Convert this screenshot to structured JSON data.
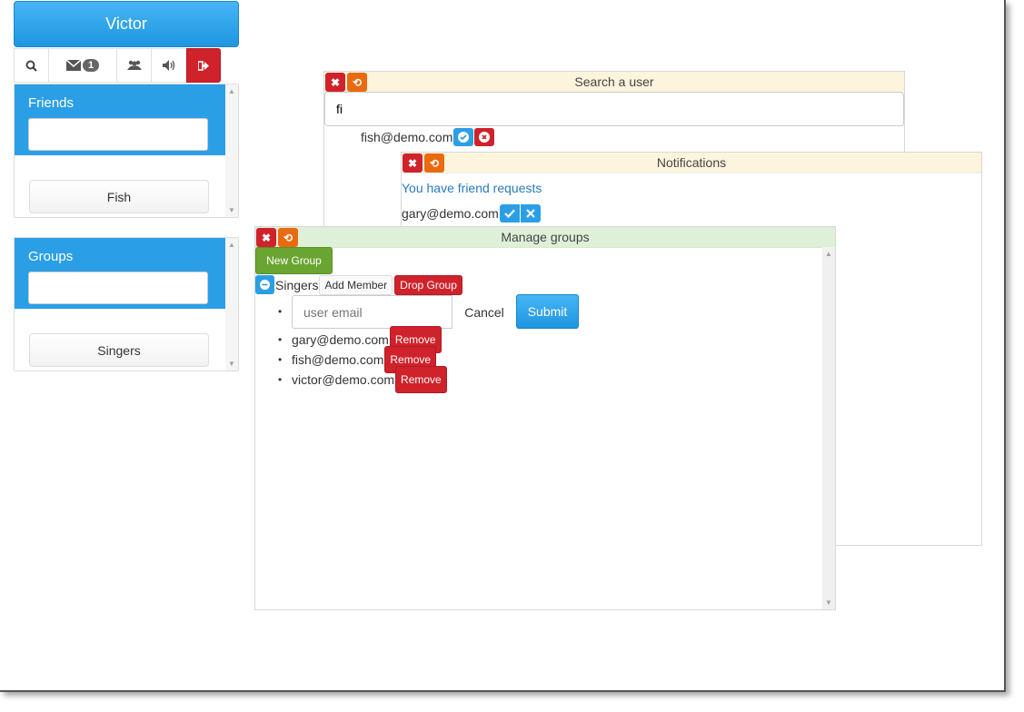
{
  "user": {
    "name": "Victor"
  },
  "toolbar": {
    "search_icon": "search-icon",
    "messages_icon": "envelope-icon",
    "messages_count": "1",
    "groups_icon": "users-icon",
    "sound_icon": "volume-icon",
    "logout_icon": "sign-out-icon"
  },
  "friends": {
    "title": "Friends",
    "search_value": "",
    "items": [
      "Fish"
    ]
  },
  "groups": {
    "title": "Groups",
    "search_value": "",
    "items": [
      "Singers"
    ]
  },
  "search_window": {
    "title": "Search a user",
    "query": "fi",
    "result_email": "fish@demo.com"
  },
  "notifications_window": {
    "title": "Notifications",
    "message": "You have friend requests",
    "request_email": "gary@demo.com"
  },
  "groups_window": {
    "title": "Manage groups",
    "new_group_label": "New Group",
    "group_name": "Singers",
    "add_member_label": "Add Member",
    "drop_group_label": "Drop Group",
    "email_placeholder": "user email",
    "cancel_label": "Cancel",
    "submit_label": "Submit",
    "remove_label": "Remove",
    "members": [
      "gary@demo.com",
      "fish@demo.com",
      "victor@demo.com"
    ]
  },
  "colors": {
    "primary": "#2b9fe6",
    "danger": "#d0222b",
    "warning": "#ea6a0f",
    "success": "#6aa531",
    "link": "#2a7bbf"
  }
}
